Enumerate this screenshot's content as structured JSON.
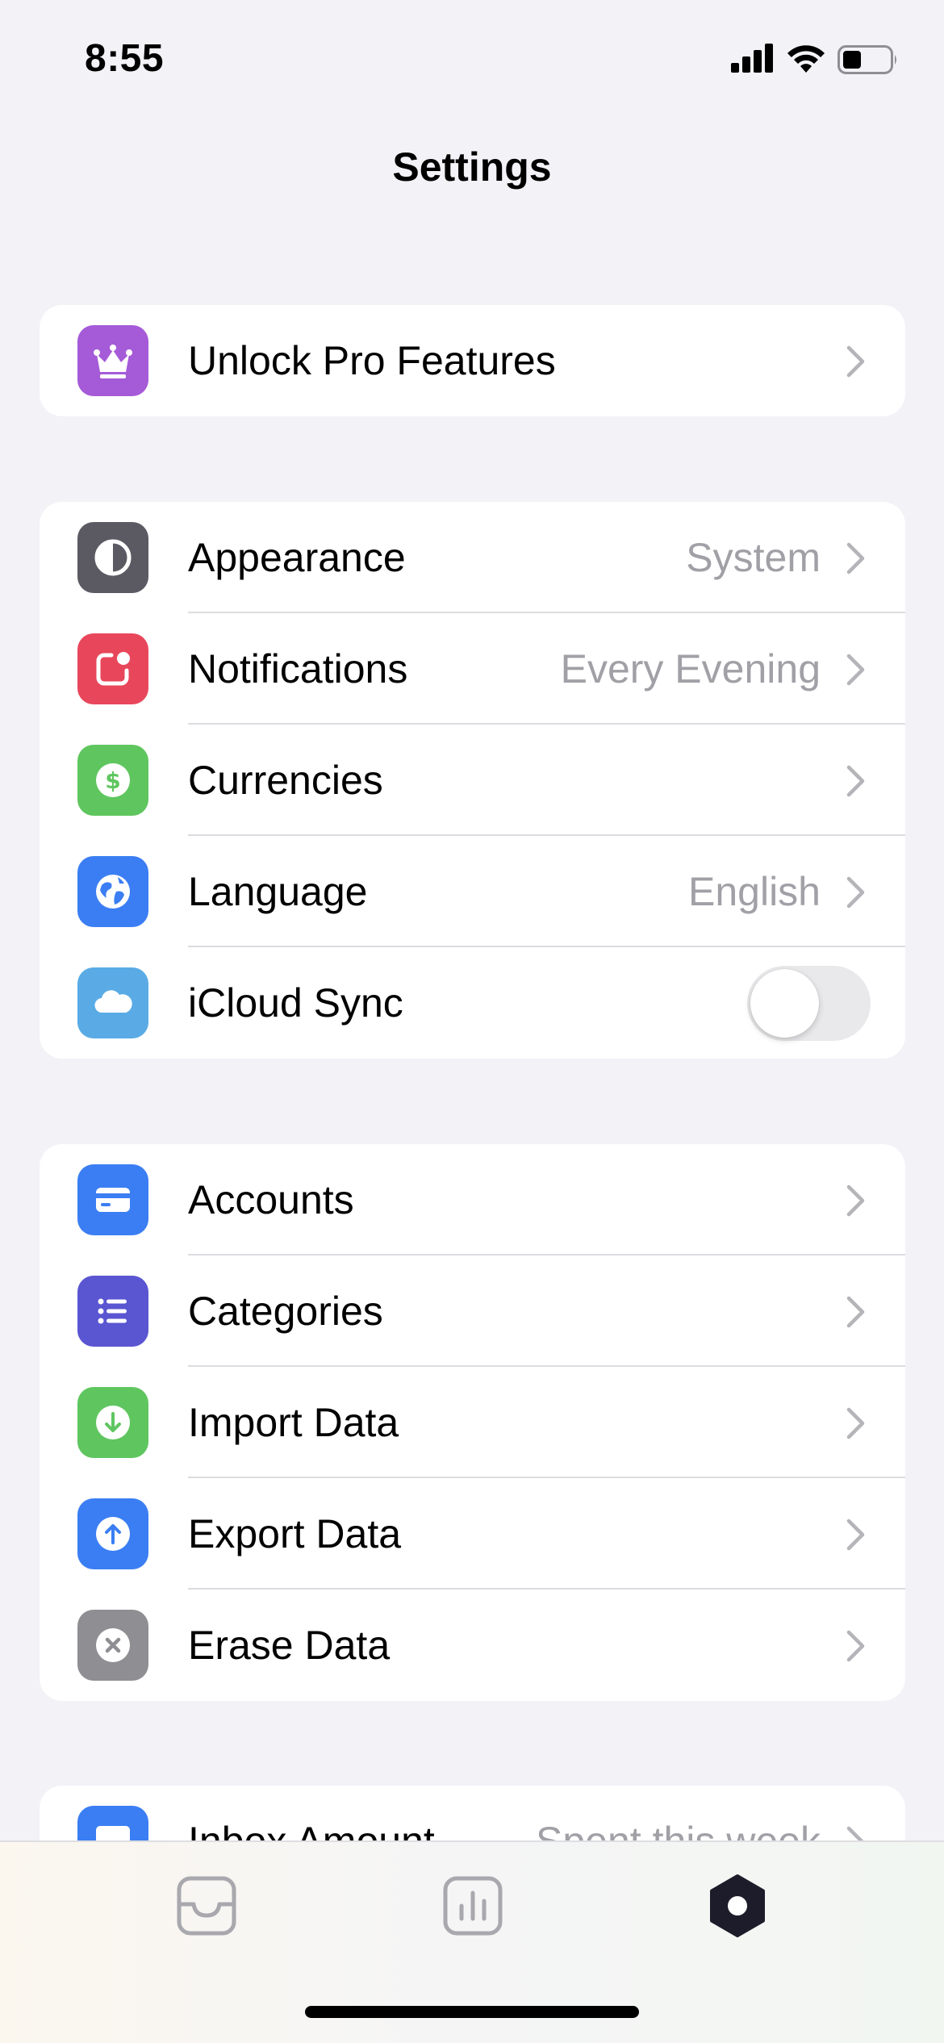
{
  "status_bar": {
    "time": "8:55"
  },
  "nav": {
    "title": "Settings"
  },
  "pro": {
    "label": "Unlock Pro Features",
    "icon": "crown-icon",
    "color": "#a55bd8"
  },
  "general": [
    {
      "label": "Appearance",
      "value": "System",
      "icon": "contrast-icon",
      "color": "#5b5a63"
    },
    {
      "label": "Notifications",
      "value": "Every Evening",
      "icon": "notification-badge-icon",
      "color": "#e8475b"
    },
    {
      "label": "Currencies",
      "value": "",
      "icon": "dollar-icon",
      "color": "#5fc65f"
    },
    {
      "label": "Language",
      "value": "English",
      "icon": "globe-icon",
      "color": "#3b7ef3"
    },
    {
      "label": "iCloud Sync",
      "value": "",
      "icon": "cloud-icon",
      "color": "#5aabe5",
      "toggle": false
    }
  ],
  "data": [
    {
      "label": "Accounts",
      "icon": "card-icon",
      "color": "#3b7ef3"
    },
    {
      "label": "Categories",
      "icon": "list-icon",
      "color": "#5a56d1"
    },
    {
      "label": "Import Data",
      "icon": "arrow-down-circle-icon",
      "color": "#5fc65f"
    },
    {
      "label": "Export Data",
      "icon": "arrow-up-circle-icon",
      "color": "#3b7ef3"
    },
    {
      "label": "Erase Data",
      "icon": "x-circle-icon",
      "color": "#8e8e93"
    }
  ],
  "partial": {
    "label": "Inbox Amount",
    "value": "Spent this week",
    "icon": "calendar-123-icon",
    "color": "#3b7ef3"
  },
  "tab_bar": {
    "tabs": [
      {
        "name": "inbox",
        "icon": "inbox-tray-icon",
        "active": false
      },
      {
        "name": "stats",
        "icon": "bar-chart-icon",
        "active": false
      },
      {
        "name": "settings",
        "icon": "settings-hexagon-icon",
        "active": true
      }
    ],
    "active_color": "#1c1c2a",
    "inactive_color": "#a8a8ae"
  }
}
